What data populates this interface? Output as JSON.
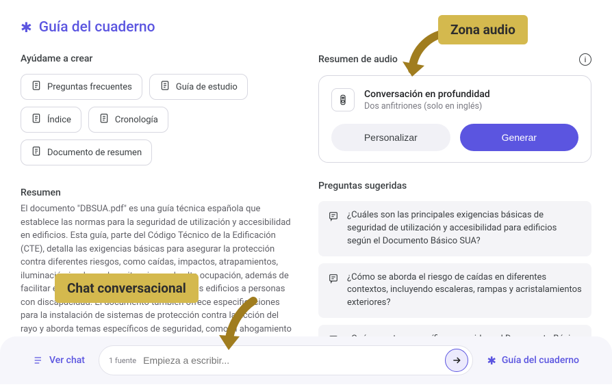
{
  "title": "Guía del cuaderno",
  "create": {
    "label": "Ayúdame a crear",
    "chips": [
      {
        "name": "chip-faq",
        "label": "Preguntas frecuentes"
      },
      {
        "name": "chip-study-guide",
        "label": "Guía de estudio"
      },
      {
        "name": "chip-index",
        "label": "Índice"
      },
      {
        "name": "chip-timeline",
        "label": "Cronología"
      },
      {
        "name": "chip-summary-doc",
        "label": "Documento de resumen"
      }
    ]
  },
  "summary": {
    "heading": "Resumen",
    "text": "El documento \"DBSUA.pdf\" es una guía técnica española que establece las normas para la seguridad de utilización y accesibilidad en edificios. Esta guía, parte del Código Técnico de la Edificación (CTE), detalla las exigencias básicas para asegurar la protección contra diferentes riesgos, como caídas, impactos, atrapamientos, iluminación inadecuada y situaciones de alta ocupación, además de facilitar el acceso y la utilización segura de los edificios a personas con discapacidad. El documento también ofrece especificaciones para la instalación de sistemas de protección contra la acción del rayo y aborda temas específicos de seguridad, como el ahogamiento en piscinas."
  },
  "audio": {
    "section_label": "Resumen de audio",
    "title": "Conversación en profundidad",
    "subtitle": "Dos anfitriones (solo en inglés)",
    "btn_personalize": "Personalizar",
    "btn_generate": "Generar"
  },
  "suggested": {
    "label": "Preguntas sugeridas",
    "items": [
      "¿Cuáles son las principales exigencias básicas de seguridad de utilización y accesibilidad para edificios según el Documento Básico SUA?",
      "¿Cómo se aborda el riesgo de caídas en diferentes contextos, incluyendo escaleras, rampas y acristalamientos exteriores?",
      "¿Qué aspectos específicos considera el Documento Básico SUA para garantizar la accesibilidad de los edificios a las personas con discapacidad?"
    ]
  },
  "bottom": {
    "chat_label": "Ver chat",
    "sources_count": "1 fuente",
    "placeholder": "Empieza a escribir...",
    "guide_label": "Guía del cuaderno"
  },
  "annotations": {
    "audio_zone": "Zona audio",
    "chat_zone": "Chat conversacional"
  }
}
